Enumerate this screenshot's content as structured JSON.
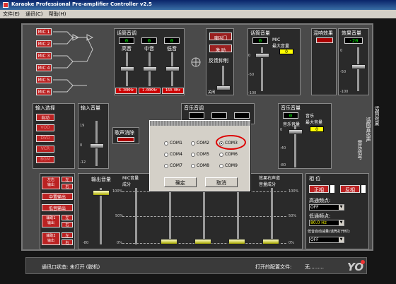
{
  "window": {
    "title": "Karaoke Professional Pre-amplifier Controller   v2.5"
  },
  "menu": [
    "文件(E)",
    "通讯(C)",
    "帮助(H)"
  ],
  "mic": {
    "labels": [
      "MIC 1",
      "MIC 2",
      "MIC 3",
      "MIC 4",
      "MIC 5",
      "MIC 6"
    ]
  },
  "speech_eq": {
    "title": "话筒音调",
    "bands": [
      "高音",
      "中音",
      "低音"
    ],
    "values": [
      "0",
      "0",
      "0"
    ],
    "freqs": [
      "6.30KHz",
      "1.00KHz",
      "160.0Hz"
    ]
  },
  "mid": {
    "buttons": [
      "啸叫门",
      "激 励"
    ],
    "feedback": "反馈抑制",
    "off": "关闭"
  },
  "speech_vol": {
    "title": "话筒音量",
    "mic_vol": "MIC音量",
    "max_label": "MIC\n最大音量",
    "value": "0",
    "scale": [
      "0",
      "-50",
      "-100"
    ]
  },
  "echo": {
    "title": "混响效果"
  },
  "effect_vol": {
    "title": "效果音量",
    "value": "-20",
    "scale": [
      "0",
      "-50",
      "-100"
    ]
  },
  "input": {
    "title": "输入选择",
    "items": [
      "自动",
      "VOD",
      "DVD",
      "VCR",
      "BGM"
    ]
  },
  "input_vol": {
    "title": "输入音量",
    "scale": [
      "19",
      "0",
      "-12"
    ]
  },
  "song_cancel": "歌声消除",
  "music_eq": {
    "title": "音乐音调"
  },
  "music_vol": {
    "title": "音乐音量",
    "labels": [
      "音乐音量",
      "音乐\n最大音量"
    ],
    "value": "0",
    "scale": [
      "0",
      "-40",
      "-80"
    ]
  },
  "side": {
    "speech_effect": "话筒效果",
    "speech_out": "话筒直达声",
    "music_signal": "音乐信号"
  },
  "outputs": {
    "buttons": [
      "左右\n输出",
      "中置输出",
      "低音输出",
      "辅助1\n输出",
      "辅助2\n输出"
    ],
    "lr": [
      "左",
      "右"
    ]
  },
  "mixer": {
    "out_vol": "输出音量",
    "mic_vol": "MIC音量\n成分",
    "lr_music": "效果右声道\n音量成分",
    "marks": [
      "100%",
      "50%",
      "0%",
      "-80"
    ]
  },
  "phase": {
    "title": "相 位",
    "pos": "正相",
    "neg": "反相",
    "hi": "高通频点:",
    "hi_val": "OFF",
    "lo": "低通频点:",
    "lo_val": "80.0   Hz",
    "auto": "低音自动减量(话筒打开时):",
    "auto_val": "OFF"
  },
  "dialog": {
    "ports": [
      "COM1",
      "COM2",
      "COM3",
      "COM4",
      "COM5",
      "COM6",
      "COM7",
      "COM8",
      "COM9"
    ],
    "selected": "COM3",
    "ok": "确定",
    "cancel": "取消"
  },
  "status": {
    "comm": "通讯口状态: 未打开 (脱机)",
    "file_label": "打开的配置文件:",
    "file_value": "无........."
  },
  "colors": {
    "accent_red": "#b22222",
    "highlight": "#ffff00",
    "selection_ring": "#dd0000"
  }
}
